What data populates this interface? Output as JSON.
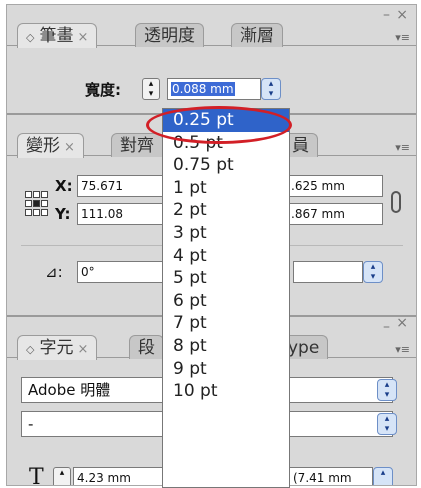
{
  "stroke_panel": {
    "tabs": [
      {
        "label": "筆畫",
        "close": "×"
      },
      {
        "label": "透明度"
      },
      {
        "label": "漸層"
      }
    ],
    "controls": {
      "close": "×",
      "minimize": "–",
      "menu": "▾≡"
    },
    "width_label": "寬度:",
    "width_value": "0.088 mm",
    "spin_up": "▴",
    "spin_down": "▾"
  },
  "transform_panel": {
    "tabs": [
      {
        "label": "變形",
        "close": "×"
      },
      {
        "label": "對齊"
      },
      {
        "label": "員"
      }
    ],
    "menu": "▾≡",
    "x_label": "X:",
    "x_value": "75.671",
    "y_label": "Y:",
    "y_value": "111.08",
    "w_value": ".625 mm",
    "h_value": ".867 mm",
    "angle_icon_text": "⊿:",
    "angle_value": "0°"
  },
  "character_panel": {
    "tabs": [
      {
        "label": "字元",
        "close": "×"
      },
      {
        "label": "段"
      },
      {
        "label": "ype"
      }
    ],
    "controls": {
      "close": "×",
      "minimize": "–",
      "menu": "▾≡"
    },
    "font_family": "Adobe 明體",
    "font_style": "-",
    "size_value": "4.23 mm",
    "leading_value": "(7.41 mm"
  },
  "dropdown": {
    "items": [
      "0.25 pt",
      "0.5 pt",
      "0.75 pt",
      "1 pt",
      "2 pt",
      "3 pt",
      "4 pt",
      "5 pt",
      "6 pt",
      "7 pt",
      "8 pt",
      "9 pt",
      "10 pt"
    ],
    "selected_index": 0,
    "highlight_color": "#d21f26"
  }
}
